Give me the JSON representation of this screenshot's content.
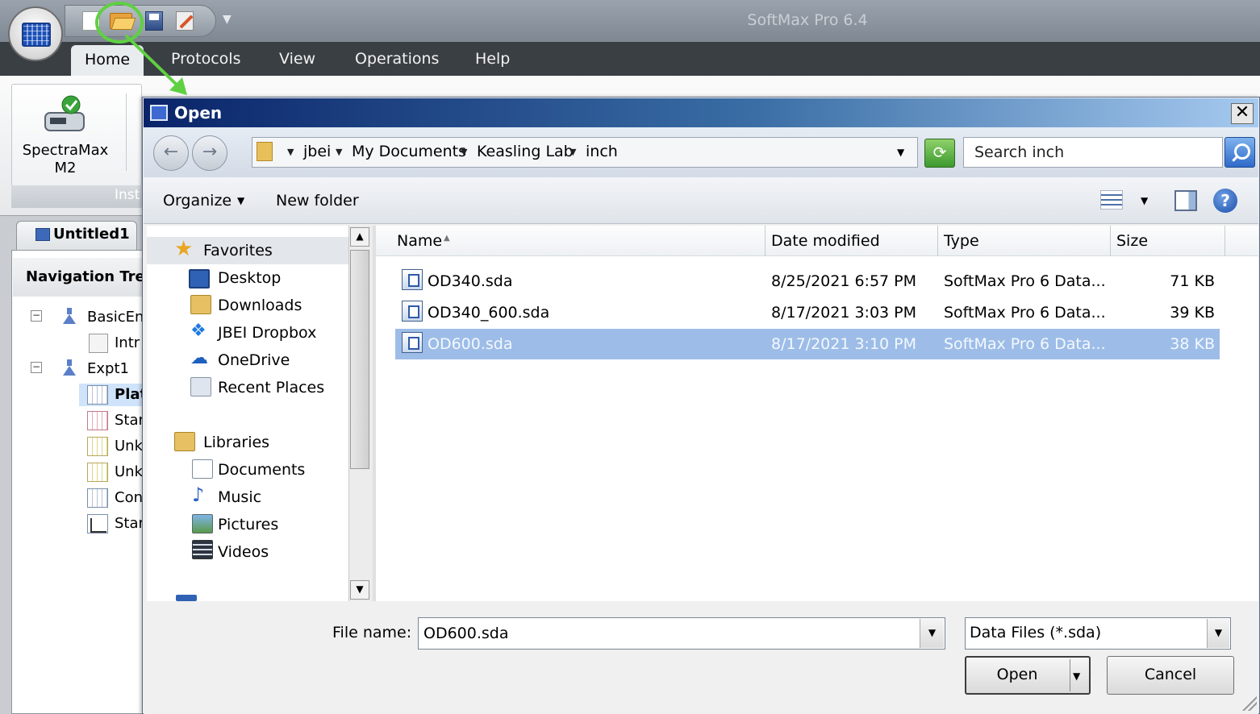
{
  "app": {
    "title": "SoftMax Pro 6.4",
    "ribbon_tabs": [
      "Home",
      "Protocols",
      "View",
      "Operations",
      "Help"
    ],
    "ribbon_group": {
      "instrument_label": "SpectraMax M2",
      "group_label": "Inst"
    },
    "document_tab": "Untitled1",
    "navigation": {
      "title": "Navigation Tree",
      "items": [
        "BasicEn",
        "Intr",
        "Expt1",
        "Plat",
        "Star",
        "Unk",
        "Unk",
        "Con",
        "Star"
      ]
    }
  },
  "dialog": {
    "title": "Open",
    "close_glyph": "✕",
    "back_glyph": "←",
    "forward_glyph": "→",
    "breadcrumb": [
      "jbei",
      "My Documents",
      "Keasling Lab",
      "inch"
    ],
    "refresh_glyph": "⟳",
    "search_placeholder": "Search inch",
    "toolbar": {
      "organize": "Organize",
      "new_folder": "New folder",
      "help_glyph": "?"
    },
    "nav_pane": {
      "favorites_header": "Favorites",
      "favorites": [
        "Desktop",
        "Downloads",
        "JBEI Dropbox",
        "OneDrive",
        "Recent Places"
      ],
      "libraries_header": "Libraries",
      "libraries": [
        "Documents",
        "Music",
        "Pictures",
        "Videos"
      ]
    },
    "columns": [
      "Name",
      "Date modified",
      "Type",
      "Size"
    ],
    "files": [
      {
        "name": "OD340.sda",
        "date": "8/25/2021 6:57 PM",
        "type": "SoftMax Pro 6 Data...",
        "size": "71 KB",
        "selected": false
      },
      {
        "name": "OD340_600.sda",
        "date": "8/17/2021 3:03 PM",
        "type": "SoftMax Pro 6 Data...",
        "size": "39 KB",
        "selected": false
      },
      {
        "name": "OD600.sda",
        "date": "8/17/2021 3:10 PM",
        "type": "SoftMax Pro 6 Data...",
        "size": "38 KB",
        "selected": true
      }
    ],
    "file_name_label": "File name:",
    "file_name_value": "OD600.sda",
    "file_type_filter": "Data Files (*.sda)",
    "open_button": "Open",
    "cancel_button": "Cancel"
  },
  "colors": {
    "highlight_ring": "#5fd042",
    "selection": "#9dbde8",
    "title_bar_start": "#0a246a"
  }
}
